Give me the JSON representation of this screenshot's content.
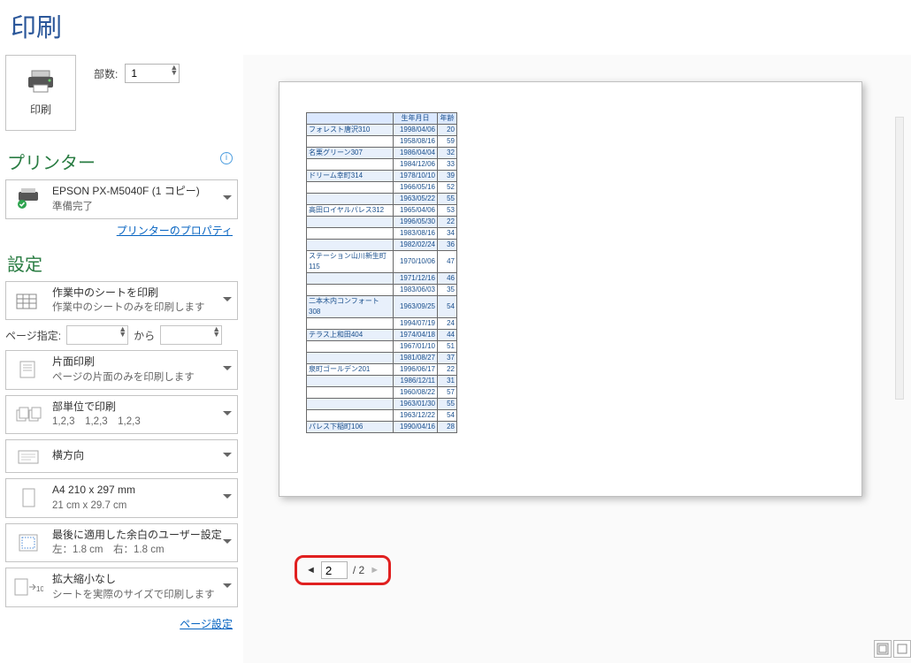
{
  "title": "印刷",
  "print_button_label": "印刷",
  "copies": {
    "label": "部数:",
    "value": "1"
  },
  "printer_section": {
    "heading": "プリンター",
    "name": "EPSON PX-M5040F (1 コピー)",
    "status": "準備完了",
    "properties_link": "プリンターのプロパティ"
  },
  "settings_section": {
    "heading": "設定",
    "print_what": {
      "l1": "作業中のシートを印刷",
      "l2": "作業中のシートのみを印刷します"
    },
    "page_range": {
      "label": "ページ指定:",
      "from": "",
      "to_label": "から",
      "to": ""
    },
    "sides": {
      "l1": "片面印刷",
      "l2": "ページの片面のみを印刷します"
    },
    "collate": {
      "l1": "部単位で印刷",
      "l2": "1,2,3　1,2,3　1,2,3"
    },
    "orientation": {
      "l1": "横方向"
    },
    "paper": {
      "l1": "A4 210 x 297 mm",
      "l2": "21 cm x 29.7 cm"
    },
    "margins": {
      "l1": "最後に適用した余白のユーザー設定",
      "l2": "左：1.8 cm　右：1.8 cm"
    },
    "scale": {
      "l1": "拡大縮小なし",
      "l2": "シートを実際のサイズで印刷します"
    },
    "page_setup_link": "ページ設定"
  },
  "preview_table": {
    "headers": [
      "",
      "生年月日",
      "年齢"
    ],
    "rows": [
      [
        "フォレスト唐沢310",
        "1998/04/06",
        "20"
      ],
      [
        "",
        "1958/08/16",
        "59"
      ],
      [
        "名栗グリーン307",
        "1986/04/04",
        "32"
      ],
      [
        "",
        "1984/12/06",
        "33"
      ],
      [
        "ドリーム幸町314",
        "1978/10/10",
        "39"
      ],
      [
        "",
        "1966/05/16",
        "52"
      ],
      [
        "",
        "1963/05/22",
        "55"
      ],
      [
        "高田ロイヤルパレス312",
        "1965/04/06",
        "53"
      ],
      [
        "",
        "1996/05/30",
        "22"
      ],
      [
        "",
        "1983/08/16",
        "34"
      ],
      [
        "",
        "1982/02/24",
        "36"
      ],
      [
        "ステーション山川新生町115",
        "1970/10/06",
        "47"
      ],
      [
        "",
        "1971/12/16",
        "46"
      ],
      [
        "",
        "1983/06/03",
        "35"
      ],
      [
        "二本木内コンフォート308",
        "1963/09/25",
        "54"
      ],
      [
        "",
        "1994/07/19",
        "24"
      ],
      [
        "テラス上和田404",
        "1974/04/18",
        "44"
      ],
      [
        "",
        "1967/01/10",
        "51"
      ],
      [
        "",
        "1981/08/27",
        "37"
      ],
      [
        "泉町ゴールデン201",
        "1996/06/17",
        "22"
      ],
      [
        "",
        "1986/12/11",
        "31"
      ],
      [
        "",
        "1960/08/22",
        "57"
      ],
      [
        "",
        "1963/01/30",
        "55"
      ],
      [
        "",
        "1963/12/22",
        "54"
      ],
      [
        "パレス下稲町106",
        "1990/04/16",
        "28"
      ]
    ]
  },
  "page_nav": {
    "current": "2",
    "total": "/ 2"
  }
}
